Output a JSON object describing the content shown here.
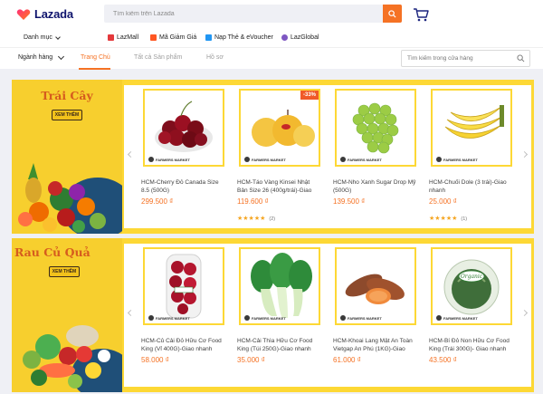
{
  "header": {
    "logo_text": "Lazada",
    "search_placeholder": "Tìm kiếm trên Lazada"
  },
  "navbar": {
    "category_label": "Danh mục",
    "links": [
      {
        "label": "LazMall",
        "color": "#e4393c"
      },
      {
        "label": "Mã Giảm Giá",
        "color": "#ff5722"
      },
      {
        "label": "Nạp Thẻ & eVoucher",
        "color": "#2196f3"
      },
      {
        "label": "LazGlobal",
        "color": "#7e57c2"
      }
    ]
  },
  "store_tabs": {
    "category_label": "Ngành hàng",
    "tabs": [
      "Trang Chủ",
      "Tất cả Sản phẩm",
      "Hồ sơ"
    ],
    "active_tab": "Trang Chủ",
    "store_search_placeholder": "Tìm kiếm trong cửa hàng"
  },
  "sections": [
    {
      "title": "Trái Cây",
      "see_more": "XEM THÊM",
      "products": [
        {
          "name": "HCM-Cherry Đỏ Canada Size 8.5 (500G)",
          "price": "299.500 ₫",
          "badge": "FARMERS MARKET",
          "image": "cherries",
          "discount": "",
          "rating": "",
          "reviews": ""
        },
        {
          "name": "HCM-Táo Vàng Kinsei Nhật Bản Size 26 (400g/trái)-Giao nhanh",
          "price": "119.600 ₫",
          "badge": "FARMERS MARKET",
          "image": "yellow-apples",
          "discount": "-33%",
          "rating": "★★★★★",
          "reviews": "(2)"
        },
        {
          "name": "HCM-Nho Xanh Sugar Drop Mỹ (500G)",
          "price": "139.500 ₫",
          "badge": "FARMERS MARKET",
          "image": "green-grapes",
          "discount": "",
          "rating": "",
          "reviews": ""
        },
        {
          "name": "HCM-Chuối Dole (3 trái)-Giao nhanh",
          "price": "25.000 ₫",
          "badge": "FARMERS MARKET",
          "image": "bananas",
          "discount": "",
          "rating": "★★★★★",
          "reviews": "(1)"
        }
      ]
    },
    {
      "title": "Rau Củ Quả",
      "see_more": "XEM THÊM",
      "products": [
        {
          "name": "HCM-Củ Cải Đỏ Hữu Cơ Food King (Vỉ 400G)-Giao nhanh",
          "price": "58.000 ₫",
          "badge": "FARMERS MARKET",
          "image": "radishes",
          "discount": "",
          "rating": "",
          "reviews": ""
        },
        {
          "name": "HCM-Cải Thìa Hữu Cơ Food King (Túi 250G)-Giao nhanh",
          "price": "35.000 ₫",
          "badge": "FARMERS MARKET",
          "image": "bok-choy",
          "discount": "",
          "rating": "",
          "reviews": ""
        },
        {
          "name": "HCM-Khoai Lang Mật An Toàn Vietgap An Phú (1KG)-Giao nhanh",
          "price": "61.000 ₫",
          "badge": "FARMERS MARKET",
          "image": "sweet-potatoes",
          "discount": "",
          "rating": "",
          "reviews": ""
        },
        {
          "name": "HCM-Bí Đỏ Non Hữu Cơ Food King (Trái 300G)- Giao nhanh",
          "price": "43.500 ₫",
          "badge": "FARMERS MARKET",
          "image": "organic-squash",
          "discount": "",
          "rating": "",
          "reviews": ""
        }
      ]
    }
  ],
  "colors": {
    "accent": "#f57224",
    "section_bg": "#fdd835",
    "price": "#f57224",
    "logo_text": "#0f146d"
  }
}
